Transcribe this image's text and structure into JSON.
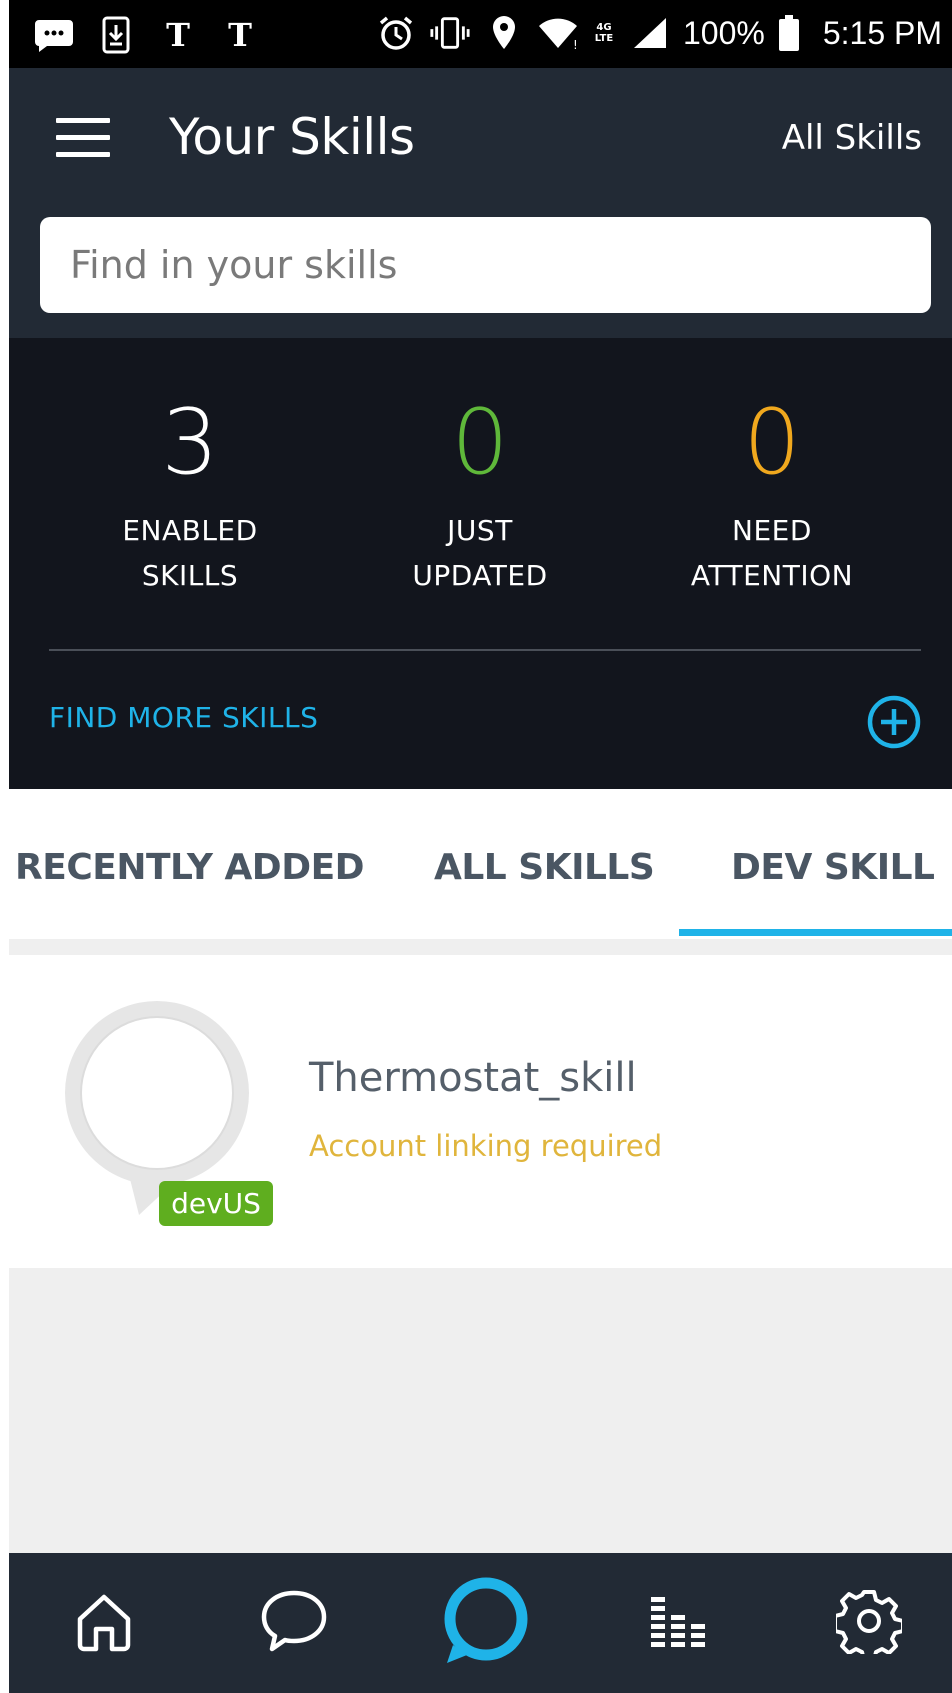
{
  "status_bar": {
    "battery": "100%",
    "time": "5:15 PM",
    "network": "4G LTE",
    "icons": [
      "message-icon",
      "download-icon",
      "nyt-icon",
      "nyt-icon",
      "alarm-icon",
      "vibrate-icon",
      "location-icon",
      "wifi-icon",
      "signal-icon",
      "battery-icon"
    ]
  },
  "header": {
    "title": "Your Skills",
    "all_skills_link": "All Skills",
    "menu_icon": "hamburger-menu-icon"
  },
  "search": {
    "placeholder": "Find in your skills",
    "value": ""
  },
  "stats": [
    {
      "value": "3",
      "label_line1": "ENABLED",
      "label_line2": "SKILLS",
      "color": "#ffffff"
    },
    {
      "value": "0",
      "label_line1": "JUST",
      "label_line2": "UPDATED",
      "color": "#5fb83a"
    },
    {
      "value": "0",
      "label_line1": "NEED",
      "label_line2": "ATTENTION",
      "color": "#f0a81e"
    }
  ],
  "find_more": {
    "label": "FIND MORE SKILLS",
    "icon": "plus-circle-icon"
  },
  "tabs": [
    {
      "label": "RECENTLY ADDED",
      "active": false
    },
    {
      "label": "ALL SKILLS",
      "active": false
    },
    {
      "label": "DEV SKILL",
      "active": true
    }
  ],
  "skills": [
    {
      "name": "Thermostat_skill",
      "status": "Account linking required",
      "badge": "devUS"
    }
  ],
  "bottom_nav": [
    {
      "name": "home",
      "icon": "home-icon"
    },
    {
      "name": "conversations",
      "icon": "chat-bubble-icon"
    },
    {
      "name": "alexa",
      "icon": "alexa-ring-icon"
    },
    {
      "name": "play",
      "icon": "equalizer-icon"
    },
    {
      "name": "settings",
      "icon": "gear-icon"
    }
  ],
  "colors": {
    "header_bg": "#222a35",
    "stats_bg": "#12151d",
    "accent": "#1fb3e8",
    "green": "#5fb83a",
    "orange": "#f0a81e",
    "warning_text": "#e0b53c",
    "badge_green": "#5fae1f"
  }
}
